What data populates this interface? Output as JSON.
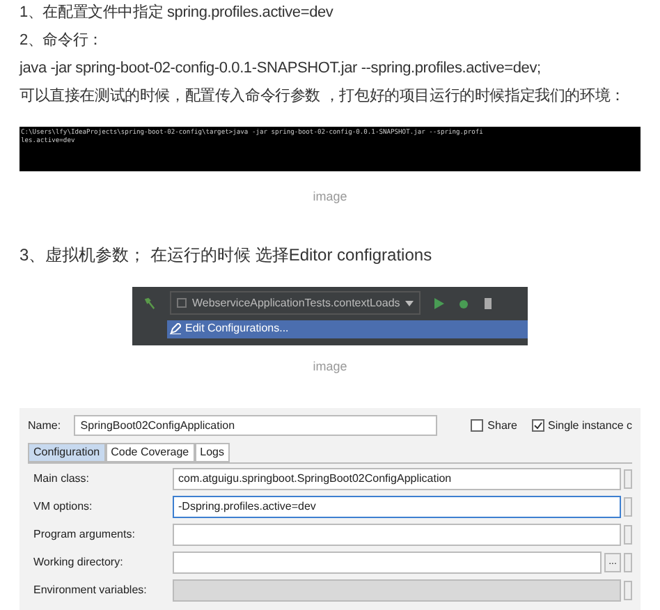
{
  "paragraphs_top": [
    "1、在配置文件中指定 spring.profiles.active=dev",
    "2、命令行：",
    "java -jar spring-boot-02-config-0.0.1-SNAPSHOT.jar --spring.profiles.active=dev;",
    "可以直接在测试的时候，配置传入命令行参数 ，打包好的项目运行的时候指定我们的环境："
  ],
  "terminal": {
    "lines": [
      "C:\\Users\\lfy\\IdeaProjects\\spring-boot-02-config\\target>java -jar spring-boot-02-config-0.0.1-SNAPSHOT.jar --spring.profi",
      "les.active=dev"
    ]
  },
  "caption_1": "image",
  "paragraph_3": "3、虚拟机参数； 在运行的时候 选择Editor configrations",
  "ide_toolbar": {
    "run_config": "WebserviceApplicationTests.contextLoads",
    "menu_item": {
      "label": "Edit Configurations...",
      "selected": true
    }
  },
  "caption_2": "image",
  "dialog": {
    "name_label": "Name:",
    "name_value": "SpringBoot02ConfigApplication",
    "checkboxes": [
      {
        "label": "Share",
        "checked": false
      },
      {
        "label": "Single instance c",
        "checked": true
      }
    ],
    "tabs": [
      {
        "label": "Configuration",
        "selected": true
      },
      {
        "label": "Code Coverage",
        "selected": false
      },
      {
        "label": "Logs",
        "selected": false
      }
    ],
    "fields": [
      {
        "label": "Main class:",
        "value": "com.atguigu.springboot.SpringBoot02ConfigApplication",
        "disabled": false,
        "focused": false
      },
      {
        "label": "VM options:",
        "value": "-Dspring.profiles.active=dev",
        "disabled": false,
        "focused": true
      },
      {
        "label": "Program arguments:",
        "disabled": false,
        "focused": false
      },
      {
        "label": "Working directory:",
        "disabled": false,
        "focused": false,
        "button": "..."
      },
      {
        "label": "Environment variables:",
        "disabled": true,
        "focused": false
      }
    ]
  }
}
